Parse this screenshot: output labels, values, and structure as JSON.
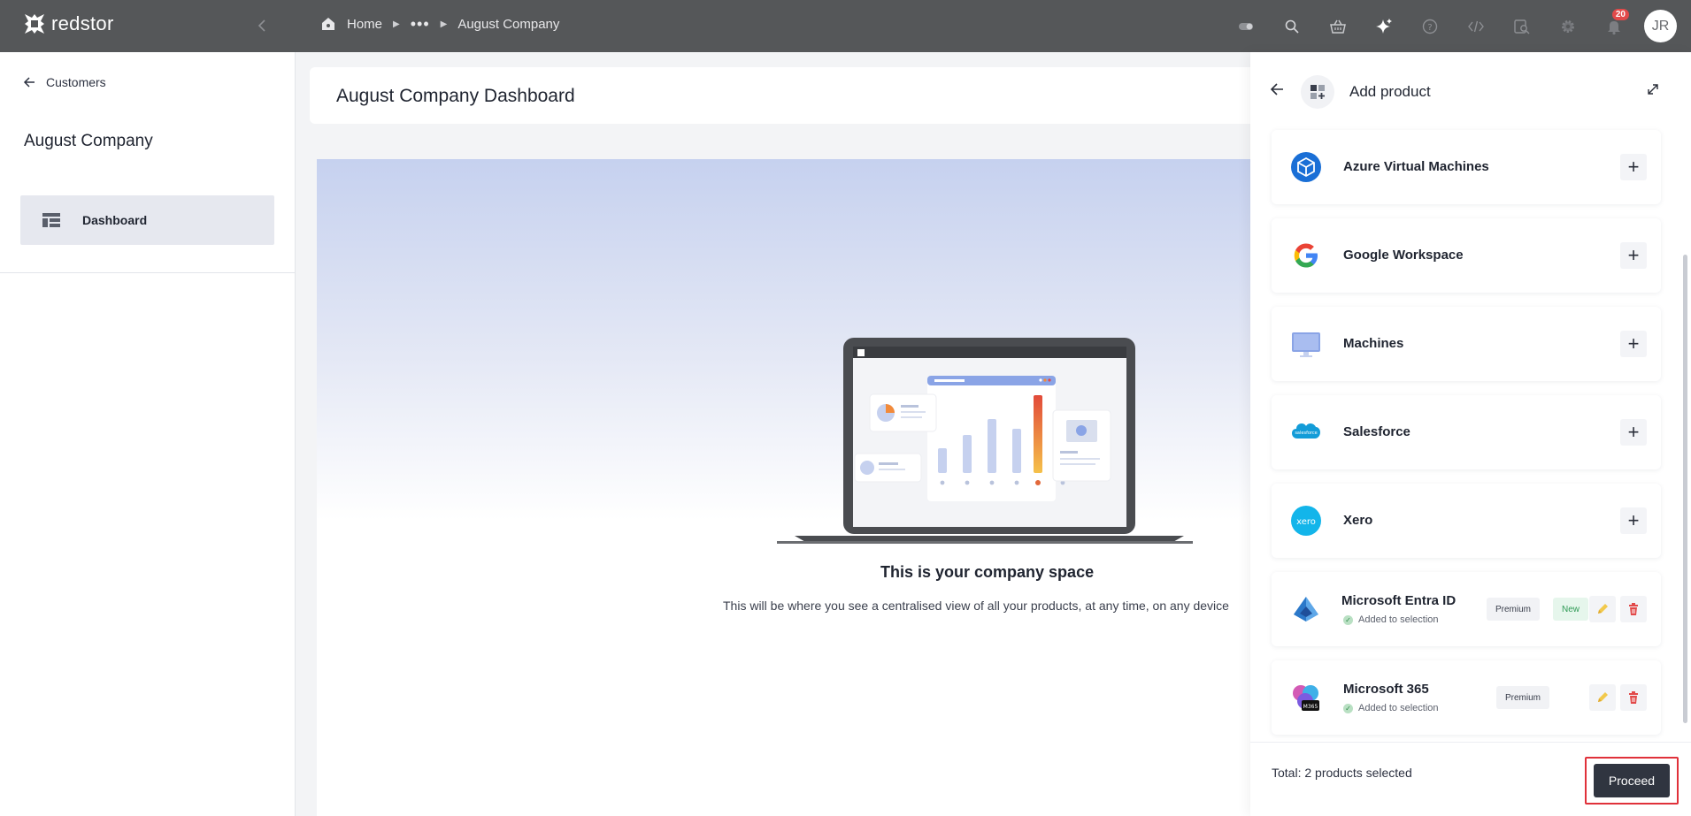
{
  "brand": {
    "name": "redstor"
  },
  "breadcrumb": {
    "home": "Home",
    "ellipsis": "•••",
    "current": "August Company"
  },
  "topbar": {
    "icons": [
      "toggle-icon",
      "search-icon",
      "basket-icon",
      "sparkle-icon",
      "help-icon",
      "code-icon",
      "inspect-icon",
      "settings-icon",
      "bell-icon"
    ],
    "notifications": "20",
    "avatar": "JR"
  },
  "sidebar": {
    "back_label": "Customers",
    "company": "August Company",
    "nav": [
      {
        "label": "Dashboard",
        "icon": "dashboard-icon",
        "active": true
      }
    ]
  },
  "main": {
    "title": "August Company Dashboard",
    "space_title": "This is your company space",
    "space_desc": "This will be where you see a centralised view of all your products, at any time, on any device"
  },
  "panel": {
    "title": "Add product",
    "products": [
      {
        "name": "Azure Virtual Machines",
        "icon": "azure-vm-icon"
      },
      {
        "name": "Google Workspace",
        "icon": "google-icon"
      },
      {
        "name": "Machines",
        "icon": "monitor-icon"
      },
      {
        "name": "Salesforce",
        "icon": "salesforce-icon",
        "icon_text": "salesforce"
      },
      {
        "name": "Xero",
        "icon": "xero-icon",
        "icon_text": "xero"
      }
    ],
    "selected": [
      {
        "name": "Microsoft Entra ID",
        "status": "Added to selection",
        "tags": [
          "Premium",
          "New"
        ]
      },
      {
        "name": "Microsoft 365",
        "status": "Added to selection",
        "tags": [
          "Premium"
        ],
        "icon_text": "M365"
      }
    ],
    "total": "Total: 2 products selected",
    "proceed": "Proceed"
  },
  "colors": {
    "topbar": "#555759",
    "proceed": "#303540",
    "highlight": "#e0313a",
    "delete": "#e24a4a",
    "edit": "#f2c94c"
  }
}
